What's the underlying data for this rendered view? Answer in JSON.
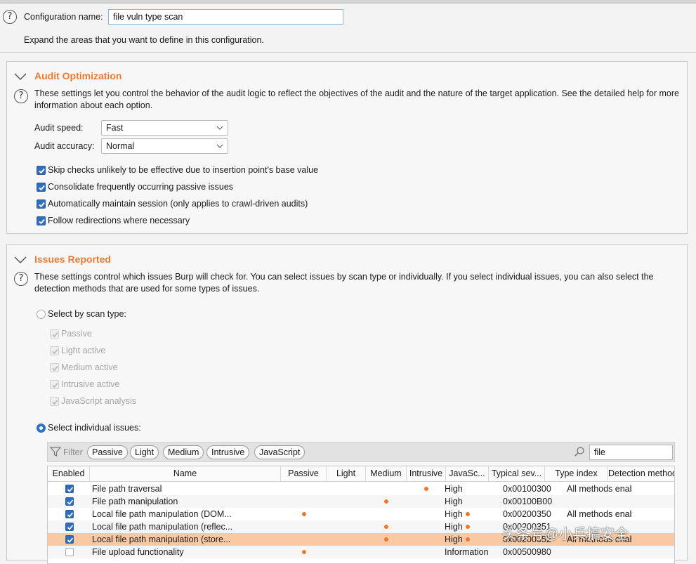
{
  "config": {
    "name_label": "Configuration name:",
    "name_value": "file vuln type scan",
    "expand_hint": "Expand the areas that you want to define in this configuration."
  },
  "audit_optimization": {
    "title": "Audit Optimization",
    "description": "These settings let you control the behavior of the audit logic to reflect the objectives of the audit and the nature of the target application. See the detailed help for more information about each option.",
    "speed_label": "Audit speed:",
    "speed_value": "Fast",
    "accuracy_label": "Audit accuracy:",
    "accuracy_value": "Normal",
    "options": [
      {
        "label": "Skip checks unlikely to be effective due to insertion point's base value",
        "checked": true
      },
      {
        "label": "Consolidate frequently occurring passive issues",
        "checked": true
      },
      {
        "label": "Automatically maintain session (only applies to crawl-driven audits)",
        "checked": true
      },
      {
        "label": "Follow redirections where necessary",
        "checked": true
      }
    ]
  },
  "issues_reported": {
    "title": "Issues Reported",
    "description": "These settings control which issues Burp will check for. You can select issues by scan type or individually. If you select individual issues, you can also select the detection methods that are used for some types of issues.",
    "scan_type_label": "Select by scan type:",
    "scan_types": [
      "Passive",
      "Light active",
      "Medium active",
      "Intrusive active",
      "JavaScript analysis"
    ],
    "individual_label": "Select individual issues:",
    "filter_label": "Filter",
    "filter_pills": [
      "Passive",
      "Light",
      "Medium",
      "Intrusive",
      "JavaScript"
    ],
    "search_value": "file",
    "columns": [
      "Enabled",
      "Name",
      "Passive",
      "Light",
      "Medium",
      "Intrusive",
      "JavaSc...",
      "Typical sev...",
      "Type index",
      "Detection methods"
    ],
    "rows": [
      {
        "enabled": true,
        "name": "File path traversal",
        "passive": false,
        "light": false,
        "medium": false,
        "intrusive": true,
        "javascript": false,
        "severity": "High",
        "type_index": "0x00100300",
        "detection": "All methods enabled"
      },
      {
        "enabled": true,
        "name": "File path manipulation",
        "passive": false,
        "light": false,
        "medium": true,
        "intrusive": false,
        "javascript": false,
        "severity": "High",
        "type_index": "0x00100B00",
        "detection": ""
      },
      {
        "enabled": true,
        "name": "Local file path manipulation (DOM...",
        "passive": true,
        "light": false,
        "medium": false,
        "intrusive": false,
        "javascript": true,
        "severity": "High",
        "type_index": "0x00200350",
        "detection": "All methods enabled"
      },
      {
        "enabled": true,
        "name": "Local file path manipulation (reflec...",
        "passive": false,
        "light": false,
        "medium": true,
        "intrusive": false,
        "javascript": true,
        "severity": "High",
        "type_index": "0x00200351",
        "detection": ""
      },
      {
        "enabled": true,
        "name": "Local file path manipulation (store...",
        "passive": false,
        "light": false,
        "medium": true,
        "intrusive": false,
        "javascript": true,
        "severity": "High",
        "type_index": "0x00200352",
        "detection": "All methods enabled",
        "highlighted": true
      },
      {
        "enabled": false,
        "name": "File upload functionality",
        "passive": true,
        "light": false,
        "medium": false,
        "intrusive": false,
        "javascript": false,
        "severity": "Information",
        "type_index": "0x00500980",
        "detection": ""
      }
    ]
  },
  "watermark": "头条号@小兵搞安全",
  "colors": {
    "accent": "#ef7a2e",
    "checkbox": "#2d6fbd",
    "highlight_row": "#f9c9a3"
  }
}
